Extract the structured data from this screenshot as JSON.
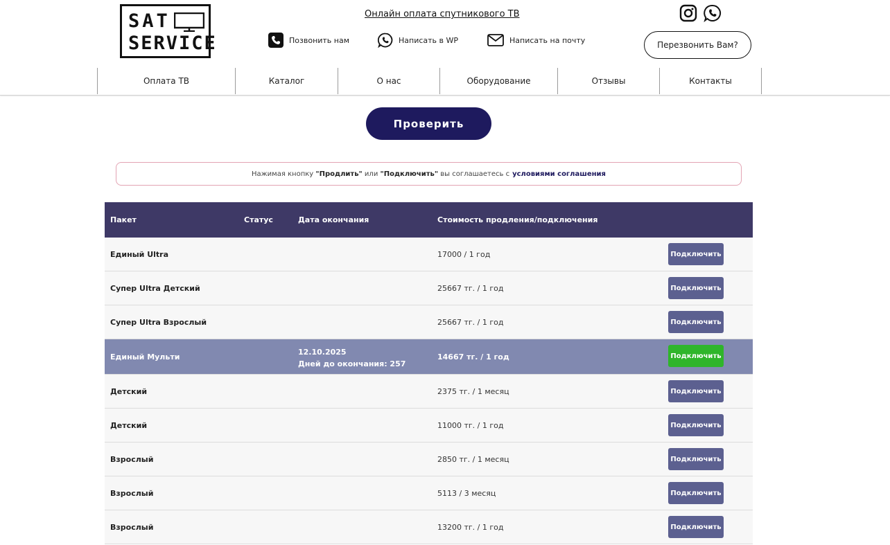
{
  "header": {
    "logo_line1": "SAT",
    "logo_line2": "SERVICE",
    "online_payment_link": "Онлайн оплата спутникового ТВ",
    "contacts": [
      {
        "label": "Позвонить нам",
        "icon": "phone-icon"
      },
      {
        "label": "Написать в WP",
        "icon": "whatsapp-icon"
      },
      {
        "label": "Написать на почту",
        "icon": "mail-icon"
      }
    ],
    "social": [
      "instagram-icon",
      "whatsapp-icon"
    ],
    "callback_button": "Перезвонить Вам?"
  },
  "nav": {
    "items": [
      "Оплата ТВ",
      "Каталог",
      "О нас",
      "Оборудование",
      "Отзывы",
      "Контакты"
    ]
  },
  "check_button": "Проверить",
  "notice": {
    "prefix": "Нажимая кнопку ",
    "btn1": "\"Продлить\"",
    "middle": " или ",
    "btn2": "\"Подключить\"",
    "suffix": " вы соглашаетесь с",
    "link": "условиями соглашения"
  },
  "table": {
    "headers": [
      "Пакет",
      "Статус",
      "Дата окончания",
      "Стоимость продления/подключения"
    ],
    "rows": [
      {
        "package": "Единый Ultra",
        "price": "17000 / 1 год",
        "button": "Подключить"
      },
      {
        "package": "Супер Ultra Детский",
        "price": "25667 тг. / 1 год",
        "button": "Подключить"
      },
      {
        "package": "Супер Ultra Взрослый",
        "price": "25667 тг. / 1 год",
        "button": "Подключить"
      },
      {
        "package": "Единый Мульти",
        "end_date": "12.10.2025",
        "days_left": "Дней до окончания: 257",
        "price": "14667 тг. / 1 год",
        "button": "Подключить"
      },
      {
        "package": "Детский",
        "price": "2375 тг. / 1 месяц",
        "button": "Подключить"
      },
      {
        "package": "Детский",
        "price": "11000 тг. / 1 год",
        "button": "Подключить"
      },
      {
        "package": "Взрослый",
        "price": "2850 тг. / 1 месяц",
        "button": "Подключить"
      },
      {
        "package": "Взрослый",
        "price": "5113 / 3 месяц",
        "button": "Подключить"
      },
      {
        "package": "Взрослый",
        "price": "13200 тг. / 1 год",
        "button": "Подключить"
      }
    ]
  },
  "colors": {
    "brand_dark": "#1e1a5e",
    "table_header": "#3e3966",
    "row_button": "#5c6090",
    "highlight_row": "#8189b0",
    "highlight_button": "#2fb52a"
  }
}
